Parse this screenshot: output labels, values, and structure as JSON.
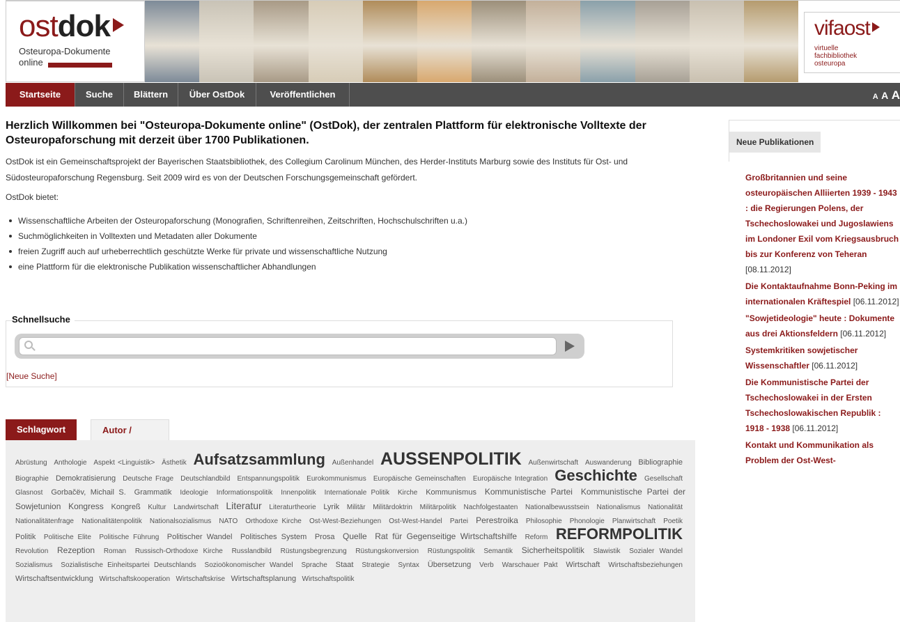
{
  "header": {
    "logo_word_light": "ost",
    "logo_word_bold": "dok",
    "logo_sub_line1": "Osteuropa-Dokumente",
    "logo_sub_line2": "online",
    "vifa_word_light": "vifa",
    "vifa_word_bold": "ost",
    "vifa_sub_line1": "virtuelle",
    "vifa_sub_line2": "fachbibliothek",
    "vifa_sub_line3": "osteuropa",
    "collage_colors": [
      "#7d8a98",
      "#c9c3b6",
      "#a89a86",
      "#d7ccb7",
      "#b08c5a",
      "#d8a86e",
      "#9c8f7a",
      "#c3b09a",
      "#8aa0aa",
      "#a7a095",
      "#c9c0b0",
      "#b59b6e"
    ]
  },
  "nav": {
    "items": [
      "Startseite",
      "Suche",
      "Blättern",
      "Über OstDok",
      "Veröffentlichen"
    ],
    "active": "Startseite",
    "fontsize_label": "A A A"
  },
  "main": {
    "heading": "Herzlich Willkommen bei \"Osteuropa-Dokumente online\" (OstDok), der zentralen Plattform für elektronische Volltexte der Osteuropaforschung mit derzeit über 1700 Publikationen.",
    "intro": "OstDok ist ein Gemeinschaftsprojekt der Bayerischen Staatsbibliothek, des Collegium Carolinum München, des Herder-Instituts Marburg sowie des Instituts für Ost- und Südosteuropaforschung Regensburg. Seit 2009 wird es von der Deutschen Forschungsgemeinschaft gefördert.",
    "offers_label": "OstDok bietet:",
    "offers": [
      "Wissenschaftliche Arbeiten der Osteuropaforschung (Monografien, Schriftenreihen, Zeitschriften, Hochschulschriften u.a.)",
      "Suchmöglichkeiten in Volltexten und Metadaten aller Dokumente",
      "freien Zugriff auch auf urheberrechtlich geschützte Werke für private und wissenschaftliche Nutzung",
      "eine Plattform für die elektronische Publikation wissenschaftlicher Abhandlungen"
    ]
  },
  "quicksearch": {
    "legend": "Schnellsuche",
    "value": "",
    "new_search": "[Neue Suche]"
  },
  "tabs": {
    "active": "Schlagwort",
    "inactive": "Autor / Herausgeber"
  },
  "cloud": [
    [
      "Abrüstung",
      "s1"
    ],
    [
      "Anthologie",
      "s1"
    ],
    [
      "Aspekt <Linguistik>",
      "s1"
    ],
    [
      "Ästhetik",
      "s1"
    ],
    [
      "Aufsatzsammlung",
      "s5"
    ],
    [
      "Außenhandel",
      "s1"
    ],
    [
      "AUSSENPOLITIK",
      "s6"
    ],
    [
      "Außenwirtschaft",
      "s1"
    ],
    [
      "Auswanderung",
      "s1"
    ],
    [
      "Bibliographie",
      "s2"
    ],
    [
      "Biographie",
      "s1"
    ],
    [
      "Demokratisierung",
      "s2"
    ],
    [
      "Deutsche Frage",
      "s1"
    ],
    [
      "Deutschlandbild",
      "s1"
    ],
    [
      "Entspannungspolitik",
      "s1"
    ],
    [
      "Eurokommunismus",
      "s1"
    ],
    [
      "Europäische Gemeinschaften",
      "s1"
    ],
    [
      "Europäische Integration",
      "s1"
    ],
    [
      "Geschichte",
      "s5"
    ],
    [
      "Gesellschaft",
      "s1"
    ],
    [
      "Glasnost",
      "s1"
    ],
    [
      "Gorbačëv, Michail S.",
      "s2"
    ],
    [
      "Grammatik",
      "s2"
    ],
    [
      "Ideologie",
      "s1"
    ],
    [
      "Informationspolitik",
      "s1"
    ],
    [
      "Innenpolitik",
      "s1"
    ],
    [
      "Internationale Politik",
      "s1"
    ],
    [
      "Kirche",
      "s1"
    ],
    [
      "Kommunismus",
      "s2"
    ],
    [
      "Kommunistische Partei",
      "s3"
    ],
    [
      "Kommunistische Partei der Sowjetunion",
      "s3"
    ],
    [
      "Kongress",
      "s3"
    ],
    [
      "Kongreß",
      "s2"
    ],
    [
      "Kultur",
      "s1"
    ],
    [
      "Landwirtschaft",
      "s1"
    ],
    [
      "Literatur",
      "s4"
    ],
    [
      "Literaturtheorie",
      "s1"
    ],
    [
      "Lyrik",
      "s2"
    ],
    [
      "Militär",
      "s1"
    ],
    [
      "Militärdoktrin",
      "s1"
    ],
    [
      "Militärpolitik",
      "s1"
    ],
    [
      "Nachfolgestaaten",
      "s1"
    ],
    [
      "Nationalbewusstsein",
      "s1"
    ],
    [
      "Nationalismus",
      "s1"
    ],
    [
      "Nationalität",
      "s1"
    ],
    [
      "Nationalitätenfrage",
      "s1"
    ],
    [
      "Nationalitätenpolitik",
      "s1"
    ],
    [
      "Nationalsozialismus",
      "s1"
    ],
    [
      "NATO",
      "s1"
    ],
    [
      "Orthodoxe Kirche",
      "s1"
    ],
    [
      "Ost-West-Beziehungen",
      "s1"
    ],
    [
      "Ost-West-Handel",
      "s1"
    ],
    [
      "Partei",
      "s1"
    ],
    [
      "Perestroika",
      "s3"
    ],
    [
      "Philosophie",
      "s1"
    ],
    [
      "Phonologie",
      "s1"
    ],
    [
      "Planwirtschaft",
      "s1"
    ],
    [
      "Poetik",
      "s1"
    ],
    [
      "Politik",
      "s2"
    ],
    [
      "Politische Elite",
      "s1"
    ],
    [
      "Politische Führung",
      "s1"
    ],
    [
      "Politischer Wandel",
      "s2"
    ],
    [
      "Politisches System",
      "s2"
    ],
    [
      "Prosa",
      "s2"
    ],
    [
      "Quelle",
      "s3"
    ],
    [
      "Rat für Gegenseitige Wirtschaftshilfe",
      "s3"
    ],
    [
      "Reform",
      "s1"
    ],
    [
      "REFORMPOLITIK",
      "s5"
    ],
    [
      "Revolution",
      "s1"
    ],
    [
      "Rezeption",
      "s3"
    ],
    [
      "Roman",
      "s1"
    ],
    [
      "Russisch-Orthodoxe Kirche",
      "s1"
    ],
    [
      "Russlandbild",
      "s1"
    ],
    [
      "Rüstungsbegrenzung",
      "s1"
    ],
    [
      "Rüstungskonversion",
      "s1"
    ],
    [
      "Rüstungspolitik",
      "s1"
    ],
    [
      "Semantik",
      "s1"
    ],
    [
      "Sicherheitspolitik",
      "s3"
    ],
    [
      "Slawistik",
      "s1"
    ],
    [
      "Sozialer Wandel",
      "s1"
    ],
    [
      "Sozialismus",
      "s1"
    ],
    [
      "Sozialistische Einheitspartei Deutschlands",
      "s1"
    ],
    [
      "Sozioökonomischer Wandel",
      "s1"
    ],
    [
      "Sprache",
      "s1"
    ],
    [
      "Staat",
      "s2"
    ],
    [
      "Strategie",
      "s1"
    ],
    [
      "Syntax",
      "s1"
    ],
    [
      "Übersetzung",
      "s2"
    ],
    [
      "Verb",
      "s1"
    ],
    [
      "Warschauer Pakt",
      "s1"
    ],
    [
      "Wirtschaft",
      "s2"
    ],
    [
      "Wirtschaftsbeziehungen",
      "s1"
    ],
    [
      "Wirtschaftsentwicklung",
      "s2"
    ],
    [
      "Wirtschaftskooperation",
      "s1"
    ],
    [
      "Wirtschaftskrise",
      "s1"
    ],
    [
      "Wirtschaftsplanung",
      "s2"
    ],
    [
      "Wirtschaftspolitik",
      "s1"
    ]
  ],
  "sidebar": {
    "tab_label": "Neue Publikationen",
    "publications": [
      {
        "title": "Großbritannien und seine osteuropäischen Alliierten 1939 - 1943 : die Regierungen Polens, der Tschechoslowakei und Jugoslawiens im Londoner Exil vom Kriegsausbruch bis zur Konferenz von Teheran",
        "date": "[08.11.2012]"
      },
      {
        "title": "Die Kontaktaufnahme Bonn-Peking im internationalen Kräftespiel",
        "date": "[06.11.2012]"
      },
      {
        "title": "\"Sowjetideologie\" heute : Dokumente aus drei Aktionsfeldern",
        "date": "[06.11.2012]"
      },
      {
        "title": "Systemkritiken sowjetischer Wissenschaftler",
        "date": "[06.11.2012]"
      },
      {
        "title": "Die Kommunistische Partei der Tschechoslowakei in der Ersten Tschechoslowakischen Republik : 1918 - 1938",
        "date": "[06.11.2012]"
      },
      {
        "title": "Kontakt und Kommunikation als Problem der Ost-West-",
        "date": ""
      }
    ]
  }
}
